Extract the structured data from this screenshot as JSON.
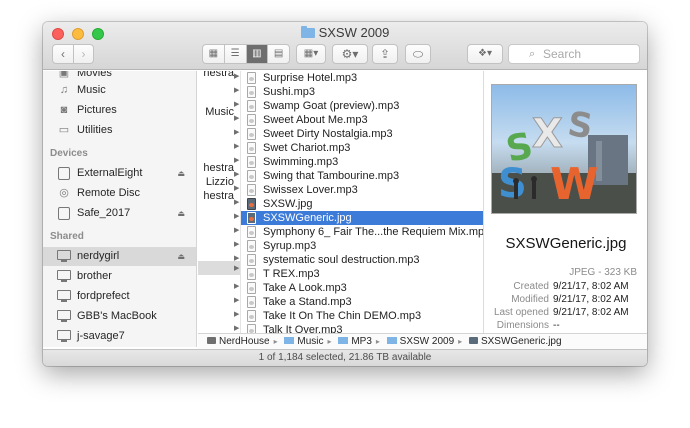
{
  "window": {
    "title": "SXSW 2009"
  },
  "toolbar": {
    "back": "‹",
    "forward": "›",
    "views": [
      "icon-view",
      "list-view",
      "column-view",
      "cover-flow-view"
    ],
    "active_view": "column-view",
    "search_placeholder": "Search"
  },
  "sidebar": {
    "favorites": [
      {
        "label": "Movies",
        "icon": "movies-icon"
      },
      {
        "label": "Music",
        "icon": "music-icon"
      },
      {
        "label": "Pictures",
        "icon": "camera-icon"
      },
      {
        "label": "Utilities",
        "icon": "folder-icon"
      }
    ],
    "devices_header": "Devices",
    "devices": [
      {
        "label": "ExternalEight",
        "icon": "drive-icon",
        "eject": true
      },
      {
        "label": "Remote Disc",
        "icon": "disc-icon",
        "eject": false
      },
      {
        "label": "Safe_2017",
        "icon": "drive-icon",
        "eject": true
      }
    ],
    "shared_header": "Shared",
    "shared": [
      {
        "label": "nerdygirl",
        "icon": "monitor-icon",
        "eject": true,
        "selected": true
      },
      {
        "label": "brother",
        "icon": "monitor-icon"
      },
      {
        "label": "fordprefect",
        "icon": "monitor-icon"
      },
      {
        "label": "GBB's MacBook",
        "icon": "monitor-icon"
      },
      {
        "label": "j-savage7",
        "icon": "monitor-icon"
      }
    ]
  },
  "column1": {
    "items": [
      "hestra",
      "Music",
      "hestra",
      "Lizzio",
      "hestra"
    ]
  },
  "files": [
    "Surprise Hotel.mp3",
    "Sushi.mp3",
    "Swamp Goat (preview).mp3",
    "Sweet About Me.mp3",
    "Sweet Dirty Nostalgia.mp3",
    "Swet Chariot.mp3",
    "Swimming.mp3",
    "Swing that Tambourine.mp3",
    "Swissex Lover.mp3",
    "SXSW.jpg",
    "SXSWGeneric.jpg",
    "Symphony 6_ Fair The...the Requiem Mix.mp3",
    "Syrup.mp3",
    "systematic soul destruction.mp3",
    "T REX.mp3",
    "Take A Look.mp3",
    "Take a Stand.mp3",
    "Take It On The Chin DEMO.mp3",
    "Talk It Over.mp3"
  ],
  "selected_file_index": 10,
  "preview": {
    "name": "SXSWGeneric.jpg",
    "type": "JPEG - 323 KB",
    "created_label": "Created",
    "created": "9/21/17, 8:02 AM",
    "modified_label": "Modified",
    "modified": "9/21/17, 8:02 AM",
    "opened_label": "Last opened",
    "opened": "9/21/17, 8:02 AM",
    "dimensions_label": "Dimensions",
    "dimensions": "--",
    "image_text": "SXSW"
  },
  "path": [
    "NerdHouse",
    "Music",
    "MP3",
    "SXSW 2009",
    "SXSWGeneric.jpg"
  ],
  "status": "1 of 1,184 selected, 21.86 TB available"
}
